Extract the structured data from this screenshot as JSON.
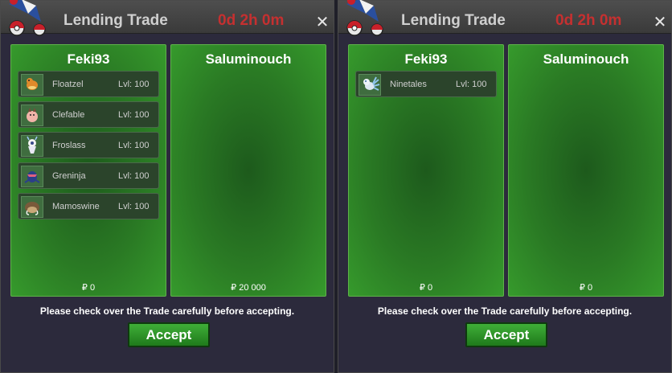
{
  "windows": [
    {
      "title": "Lending Trade",
      "timer": "0d 2h 0m",
      "close_symbol": "✕",
      "left": {
        "name": "Feki93",
        "money": "₽ 0",
        "pokemon": [
          {
            "name": "Floatzel",
            "level": "Lvl: 100"
          },
          {
            "name": "Clefable",
            "level": "Lvl: 100"
          },
          {
            "name": "Froslass",
            "level": "Lvl: 100"
          },
          {
            "name": "Greninja",
            "level": "Lvl: 100"
          },
          {
            "name": "Mamoswine",
            "level": "Lvl: 100"
          }
        ]
      },
      "right": {
        "name": "Saluminouch",
        "money": "₽ 20 000",
        "pokemon": []
      },
      "notice": "Please check over the Trade carefully before accepting.",
      "accept_label": "Accept"
    },
    {
      "title": "Lending Trade",
      "timer": "0d 2h 0m",
      "close_symbol": "✕",
      "left": {
        "name": "Feki93",
        "money": "₽ 0",
        "pokemon": [
          {
            "name": "Ninetales",
            "level": "Lvl: 100"
          }
        ]
      },
      "right": {
        "name": "Saluminouch",
        "money": "₽ 0",
        "pokemon": []
      },
      "notice": "Please check over the Trade carefully before accepting.",
      "accept_label": "Accept"
    }
  ]
}
